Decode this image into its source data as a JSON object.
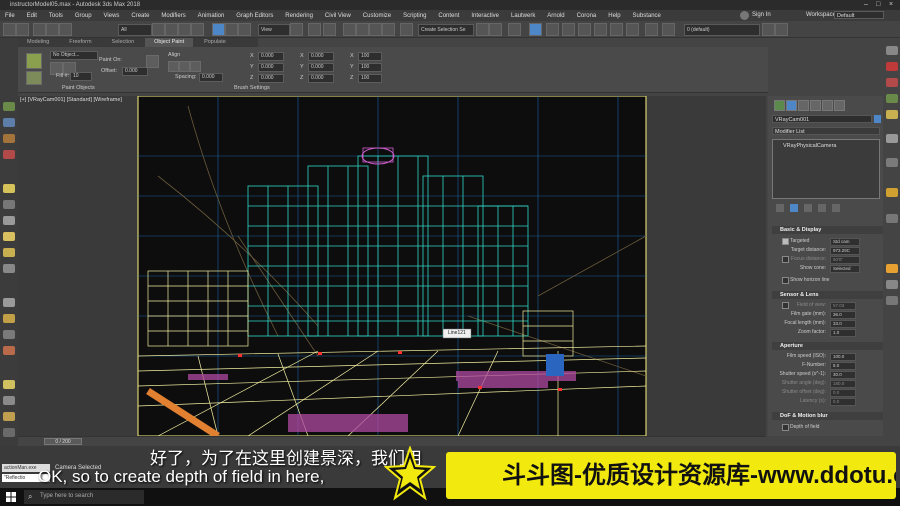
{
  "window": {
    "title": "instructorModel05.max - Autodesk 3ds Max 2018"
  },
  "menubar": {
    "items": [
      "File",
      "Edit",
      "Tools",
      "Group",
      "Views",
      "Create",
      "Modifiers",
      "Animation",
      "Graph Editors",
      "Rendering",
      "Civil View",
      "Customize",
      "Scripting",
      "Content",
      "Interactive",
      "Lautwerk",
      "Arnold",
      "Corona",
      "Help",
      "Substance"
    ]
  },
  "signin": "Sign In",
  "workspaces": {
    "label": "Workspaces:",
    "value": "Default"
  },
  "toolbar": {
    "undo_dropdown": "All",
    "view_dropdown": "View",
    "selection_set": "Create Selection Se",
    "layer_dropdown": "0 (default)"
  },
  "ribbon": {
    "tabs": [
      "Modeling",
      "Freeform",
      "Selection",
      "Object Paint",
      "Populate"
    ],
    "active_tab": "Object Paint",
    "no_object": "No Object...",
    "paint_on": "Paint On:",
    "fill_label": "Fill #:",
    "fill_value": "10",
    "offset_label": "Offset:",
    "offset_value": "0.000",
    "align_label": "Align",
    "spacing_label": "Spacing:",
    "spacing_value": "0.000",
    "section_paint_objects": "Paint Objects",
    "section_brush_settings": "Brush Settings",
    "coord_labels": [
      "X",
      "Y",
      "Z"
    ],
    "coord_values": [
      "0.000",
      "0.000",
      "0.000"
    ],
    "scale_values": [
      "100",
      "100",
      "100"
    ]
  },
  "viewport": {
    "label": "[+] [VRayCam001] [Standard] [Wireframe]",
    "tooltip": "Line121"
  },
  "command_panel": {
    "object_name": "VRayCam001",
    "modifier_list": "Modifier List",
    "stack_item": "VRayPhysicalCamera",
    "rollouts": {
      "basic_display": "Basic & Display",
      "sensor_lens": "Sensor & Lens",
      "aperture": "Aperture",
      "dof_motion": "DoF & Motion blur"
    },
    "basic": {
      "targeted_label": "Targeted",
      "targeted_value": "Std cam",
      "target_distance_label": "Target distance:",
      "target_distance_value": "973.29C",
      "focus_distance_label": "Focus distance:",
      "focus_distance_value": "50'0\"",
      "show_cone_label": "Show cone:",
      "show_cone_value": "Selected",
      "show_horizon": "Show horizon line"
    },
    "sensor": {
      "fov_label": "Field of view:",
      "fov_value": "57.03",
      "film_gate_label": "Film gate (mm):",
      "film_gate_value": "36.0",
      "focal_length_label": "Focal length (mm):",
      "focal_length_value": "33.0",
      "zoom_label": "Zoom factor:",
      "zoom_value": "1.0"
    },
    "aperture": {
      "film_speed_label": "Film speed (ISO):",
      "film_speed_value": "100.0",
      "fnumber_label": "F-Number:",
      "fnumber_value": "8.0",
      "shutter_speed_label": "Shutter speed (s^-1):",
      "shutter_speed_value": "30.0",
      "shutter_angle_label": "Shutter angle (deg):",
      "shutter_angle_value": "180.0",
      "shutter_offset_label": "Shutter offset (deg):",
      "shutter_offset_value": "0.0",
      "latency_label": "Latency (s):",
      "latency_value": "0.0"
    },
    "dof": {
      "depth_of_field": "Depth of field"
    }
  },
  "timeline": {
    "frame": "0 / 200"
  },
  "status": {
    "maxscript_1": "actionMan.exe",
    "maxscript_2": "\"Reflectio",
    "selection": "Camera Selected"
  },
  "taskbar": {
    "search_placeholder": "Type here to search"
  },
  "subtitles": {
    "cn": "好了，为了在这里创建景深，我们用",
    "en": "OK, so to create depth of field in here,"
  },
  "watermark": {
    "text": "斗斗图-优质设计资源库-www.ddotu.com"
  },
  "colors": {
    "accent": "#4d87c7",
    "wire_cyan": "#2fd8c8",
    "wire_yellow": "#f3efa0",
    "watermark_bg": "#f2ea0f"
  }
}
